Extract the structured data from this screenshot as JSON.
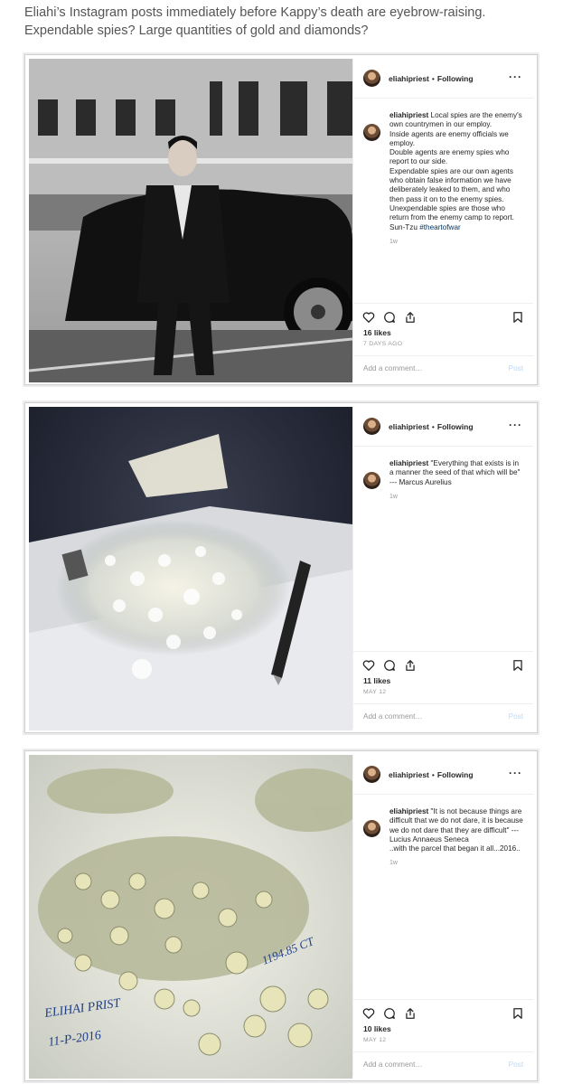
{
  "intro": "Eliahi’s Instagram posts immediately before Kappy’s death are eyebrow-raising. Expendable spies? Large quantities of gold and diamonds?",
  "colors": {
    "link": "#003569",
    "muted": "#999999",
    "post_button": "#b3dbff"
  },
  "posts": [
    {
      "username": "eliahipriest",
      "separator": "•",
      "follow_label": "Following",
      "more_icon": "more-horizontal-icon",
      "caption_user": "eliahipriest",
      "caption": " Local spies are the enemy's own countrymen in our employ.\nInside agents are enemy officials we employ.\nDouble agents are enemy spies who report to our side.\nExpendable spies are our own agents who obtain false information we have deliberately leaked to them, and who then pass it on to the enemy spies.\nUnexpendable spies are those who return from the enemy camp to report.\nSun-Tzu ",
      "hashtag": "#theartofwar",
      "age": "1w",
      "likes": "16 likes",
      "date": "7 DAYS AGO",
      "comment_placeholder": "Add a comment…",
      "post_label": "Post"
    },
    {
      "username": "eliahipriest",
      "separator": "•",
      "follow_label": "Following",
      "more_icon": "more-horizontal-icon",
      "caption_user": "eliahipriest",
      "caption": " \"Everything that exists is in a manner the seed of that which will be\" --- Marcus Aurelius",
      "hashtag": "",
      "age": "1w",
      "likes": "11 likes",
      "date": "MAY 12",
      "comment_placeholder": "Add a comment…",
      "post_label": "Post"
    },
    {
      "username": "eliahipriest",
      "separator": "•",
      "follow_label": "Following",
      "more_icon": "more-horizontal-icon",
      "caption_user": "eliahipriest",
      "caption": " \"It is not because things are difficult that we do not dare, it is because we do not dare that they are difficult\" --- Lucius Annaeus Seneca\n..with the parcel that began it all...2016..",
      "hashtag": "",
      "age": "1w",
      "likes": "10 likes",
      "date": "MAY 12",
      "comment_placeholder": "Add a comment…",
      "post_label": "Post",
      "photo_handwriting": [
        "ELIHAI PRIST",
        "11-P-2016",
        "1194.85 CT"
      ]
    }
  ]
}
